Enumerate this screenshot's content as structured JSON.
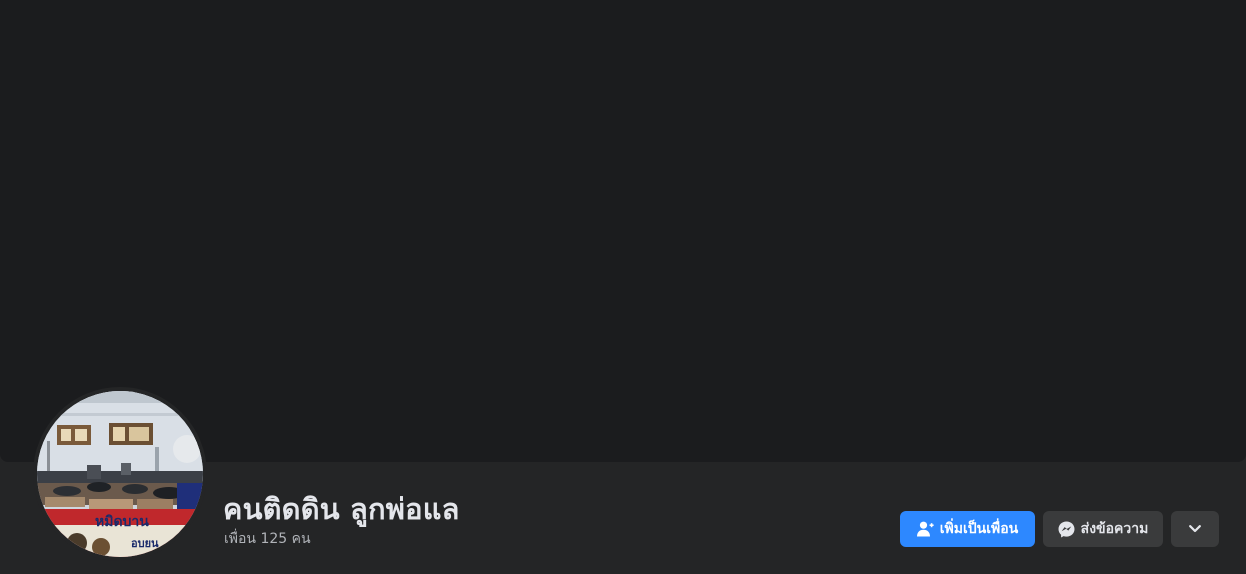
{
  "profile": {
    "name": "คนติดดิน ลูกพ่อแล",
    "friends_text": "เพื่อน 125 คน"
  },
  "actions": {
    "add_friend_label": "เพิ่มเป็นเพื่อน",
    "message_label": "ส่งข้อความ",
    "add_friend_icon": "user-plus-icon",
    "message_icon": "messenger-icon",
    "more_icon": "chevron-down-icon"
  },
  "colors": {
    "primary_button": "#2d88ff",
    "secondary_button": "#3a3b3c",
    "cover_background": "#1b1c1e",
    "page_background": "#242526"
  }
}
